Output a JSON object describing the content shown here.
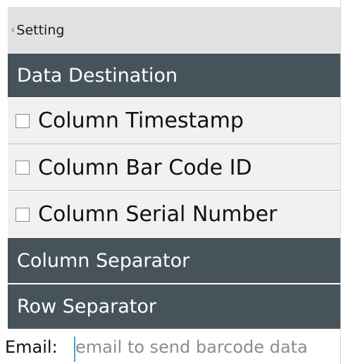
{
  "nav": {
    "back_chevron": "‹",
    "back_label": "Setting"
  },
  "sections": {
    "data_destination": "Data Destination",
    "column_separator": "Column Separator",
    "row_separator": "Row Separator"
  },
  "options": [
    {
      "label": "Column Timestamp",
      "checked": false
    },
    {
      "label": "Column Bar Code ID",
      "checked": false
    },
    {
      "label": "Column Serial Number",
      "checked": false
    }
  ],
  "email": {
    "label": "Email:",
    "value": "",
    "placeholder": "email to send barcode data"
  },
  "colors": {
    "nav_background": "#e2e2e2",
    "section_header": "#47535a",
    "row_background": "#f1f1f1",
    "caret": "#4aa3c9"
  }
}
